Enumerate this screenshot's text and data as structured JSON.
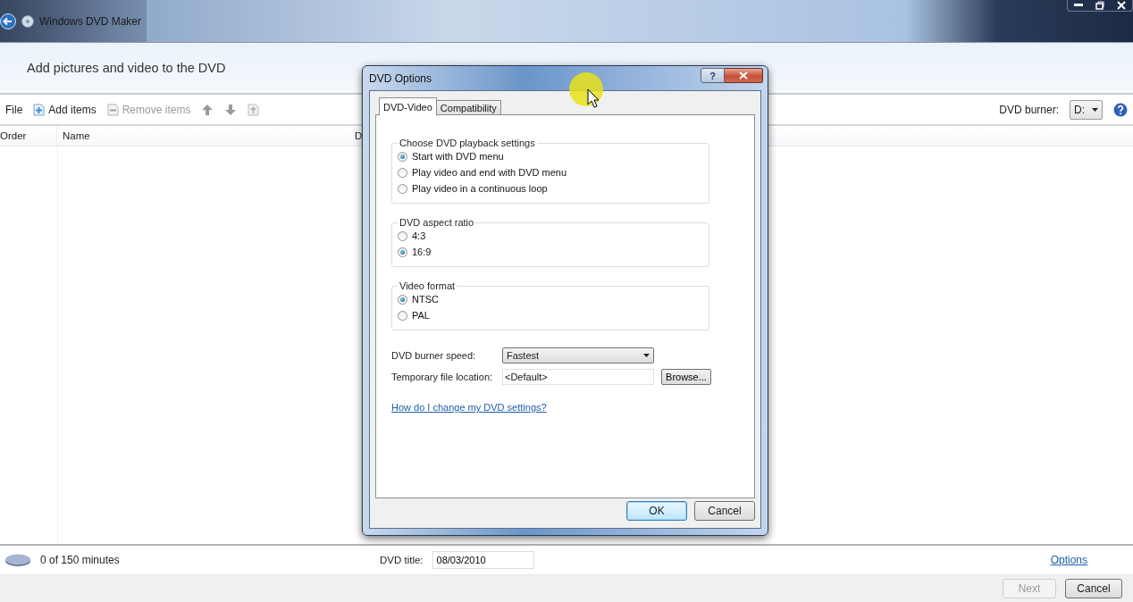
{
  "window": {
    "title": "Windows DVD Maker",
    "heading": "Add pictures and video to the DVD"
  },
  "toolbar": {
    "items": [
      {
        "kind": "menu",
        "label": "File",
        "disabled": false
      },
      {
        "kind": "add",
        "label": "Add items",
        "disabled": false
      },
      {
        "kind": "remove",
        "label": "Remove items",
        "disabled": true
      }
    ],
    "burner_label": "DVD burner:",
    "burner_value": "D:"
  },
  "table": {
    "columns": [
      "Order",
      "Name",
      "D"
    ]
  },
  "status_bar": {
    "minutes": "0 of 150 minutes",
    "title_label": "DVD title:",
    "title_value": "08/03/2010",
    "options_link": "Options"
  },
  "footer": {
    "buttons": [
      {
        "label": "Next",
        "disabled": true
      },
      {
        "label": "Cancel",
        "disabled": false
      }
    ]
  },
  "dialog": {
    "title": "DVD Options",
    "help_button": "?",
    "tabs": [
      {
        "label": "DVD-Video",
        "selected": true
      },
      {
        "label": "Compatibility",
        "selected": false
      }
    ],
    "groups": [
      {
        "legend": "Choose DVD playback settings",
        "options": [
          {
            "label": "Start with DVD menu",
            "selected": true
          },
          {
            "label": "Play video and end with DVD menu",
            "selected": false
          },
          {
            "label": "Play video in a continuous loop",
            "selected": false
          }
        ]
      },
      {
        "legend": "DVD aspect ratio",
        "options": [
          {
            "label": "4:3",
            "selected": false
          },
          {
            "label": "16:9",
            "selected": true
          }
        ]
      },
      {
        "legend": "Video format",
        "options": [
          {
            "label": "NTSC",
            "selected": true
          },
          {
            "label": "PAL",
            "selected": false
          }
        ]
      }
    ],
    "speed": {
      "label": "DVD burner speed:",
      "value": "Fastest"
    },
    "temp": {
      "label": "Temporary file location:",
      "value": "<Default>"
    },
    "browse": "Browse...",
    "help_link": "How do I change my DVD settings?",
    "buttons": [
      {
        "label": "OK",
        "default": true
      },
      {
        "label": "Cancel",
        "default": false
      }
    ]
  }
}
